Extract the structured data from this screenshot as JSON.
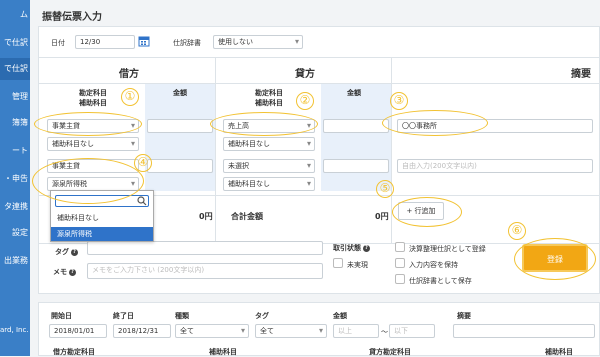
{
  "sidebar": {
    "items": [
      {
        "label": "ム",
        "active": false
      },
      {
        "label": "で仕訳",
        "active": false
      },
      {
        "label": "で仕訳",
        "active": true
      },
      {
        "label": "管理",
        "active": false
      },
      {
        "label": "簿簿",
        "active": false
      },
      {
        "label": "ート",
        "active": false
      },
      {
        "label": "・申告",
        "active": false
      },
      {
        "label": "タ連携",
        "active": false
      },
      {
        "label": "設定",
        "active": false
      },
      {
        "label": "出業務",
        "active": false
      }
    ],
    "footer": "ard, Inc."
  },
  "header": {
    "title": "振替伝票入力"
  },
  "form": {
    "date_label": "日付",
    "date_value": "12/30",
    "dict_label": "仕訳辞書",
    "dict_value": "使用しない",
    "debit_heading": "借方",
    "credit_heading": "貸方",
    "summary_heading": "摘要",
    "account_label": "勘定科目",
    "subaccount_label": "補助科目",
    "amount_label": "金額",
    "debit_rows": [
      {
        "account": "事業主貸",
        "sub": "補助科目なし"
      },
      {
        "account": "事業主貸",
        "sub": "源泉所得税"
      }
    ],
    "credit_rows": [
      {
        "account": "売上高",
        "sub": "補助科目なし"
      },
      {
        "account": "未選択",
        "sub": "補助科目なし"
      }
    ],
    "summary_rows": [
      "〇〇事務所",
      "自由入力(200文字以内)"
    ],
    "dropdown": {
      "items": [
        "補助科目なし",
        "源泉所得税"
      ],
      "selected": 1
    },
    "debit_total": "0円",
    "credit_total_label": "合計金額",
    "credit_total": "0円",
    "add_row_label": "+ 行追加",
    "tag_label": "タグ",
    "memo_label": "メモ",
    "memo_placeholder": "メモをご入力下さい (200文字以内)",
    "status_label": "取引状態",
    "status_option": "未実現",
    "options": [
      "決算整理仕訳として登録",
      "入力内容を保持",
      "仕訳辞書として保存"
    ],
    "register_label": "登録"
  },
  "annotations": [
    "①",
    "②",
    "③",
    "④",
    "⑤",
    "⑥"
  ],
  "search": {
    "headers": [
      "開始日",
      "終了日",
      "種類",
      "タグ",
      "金額",
      "摘要"
    ],
    "start_date": "2018/01/01",
    "end_date": "2018/12/31",
    "type_value": "全て",
    "tag_value": "全て",
    "amount_min_placeholder": "以上",
    "amount_sep": "〜",
    "amount_max_placeholder": "以下",
    "bottom_labels": [
      "借方勘定科目",
      "補助科目",
      "貸方勘定科目",
      "補助科目"
    ]
  },
  "colors": {
    "sidebar": "#3a7fc7",
    "accent": "#f2a714",
    "annotation": "#f2c232",
    "selected": "#2f73c9"
  }
}
